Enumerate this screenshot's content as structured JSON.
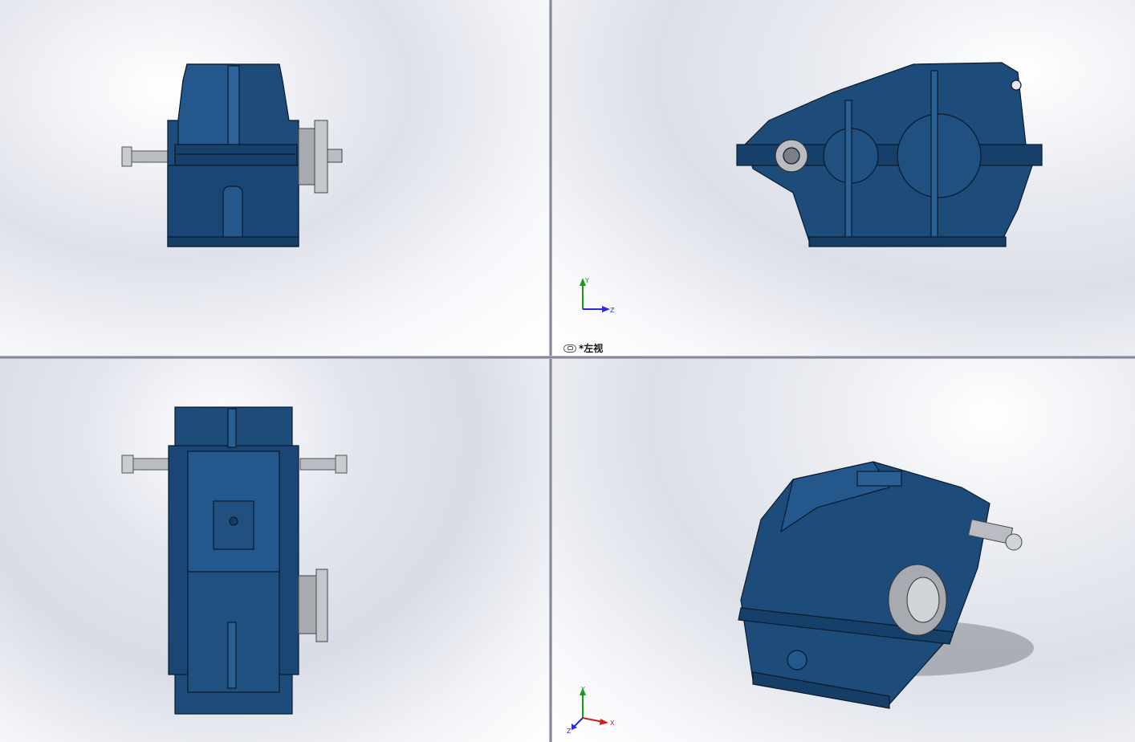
{
  "viewports": {
    "front": {
      "label": ""
    },
    "left": {
      "label": "*左视"
    },
    "top": {
      "label": ""
    },
    "isometric": {
      "label": ""
    }
  },
  "triad_left": {
    "y": "Y",
    "z": "Z"
  },
  "triad_iso": {
    "y": "Y",
    "x": "X",
    "z": "Z"
  },
  "colors": {
    "body": "#1d4b7a",
    "body_dark": "#0f2d4d",
    "edge": "#0a1a2c",
    "steel": "#b9bcc2",
    "steel_dark": "#6e7178",
    "axis_y": "#1a9c1a",
    "axis_x": "#d21e1e",
    "axis_z": "#2a2ad6"
  },
  "icons": {
    "view_link": "link-icon"
  }
}
